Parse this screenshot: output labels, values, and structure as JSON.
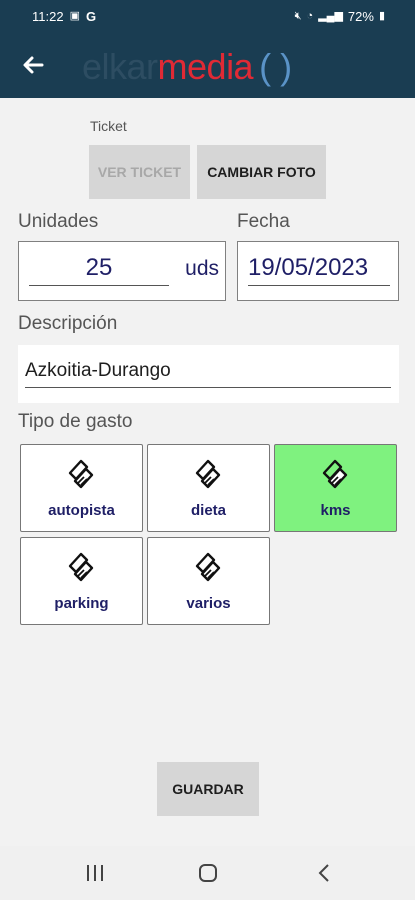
{
  "status_bar": {
    "time": "11:22",
    "battery": "72%"
  },
  "app_bar": {
    "logo_part1": "elkar",
    "logo_part2": "media",
    "logo_part3": "( )"
  },
  "ticket": {
    "label": "Ticket",
    "view_button": "VER TICKET",
    "change_photo_button": "CAMBIAR FOTO"
  },
  "units": {
    "label": "Unidades",
    "value": "25",
    "suffix": "uds"
  },
  "date": {
    "label": "Fecha",
    "value": "19/05/2023"
  },
  "description": {
    "label": "Descripción",
    "value": "Azkoitia-Durango"
  },
  "expense_type": {
    "label": "Tipo de gasto",
    "options": [
      {
        "label": "autopista",
        "selected": false
      },
      {
        "label": "dieta",
        "selected": false
      },
      {
        "label": "kms",
        "selected": true
      },
      {
        "label": "parking",
        "selected": false
      },
      {
        "label": "varios",
        "selected": false
      }
    ],
    "icon": "ticket-icon",
    "selected_color": "#7ff27f"
  },
  "save_button": "GUARDAR",
  "colors": {
    "app_bar": "#1a3d52",
    "logo_elkar": "#2d4d62",
    "logo_media": "#e02a35",
    "logo_paren": "#5a93c7",
    "value_text": "#1f1f66"
  }
}
